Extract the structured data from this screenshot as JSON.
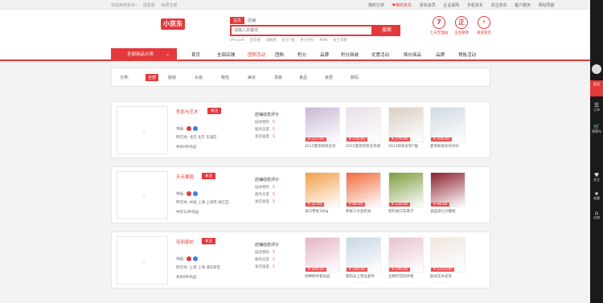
{
  "topbar": {
    "left": [
      "欢迎来到京东!",
      "请登录",
      "免费注册"
    ],
    "right": [
      "我的订单",
      "♥我的京东",
      "京东会员",
      "企业采购",
      "手机京东",
      "关注京东",
      "客户服务",
      "网站导航"
    ]
  },
  "logo": "小京东",
  "search": {
    "tabs": [
      "宝贝",
      "店铺"
    ],
    "placeholder": "请输入关键词",
    "button": "搜索",
    "hotwords": [
      "iPhone6",
      "连衣裙",
      "凉拖鞋",
      "女士T恤",
      "男士衬衫",
      "MINI",
      "女士凉鞋"
    ]
  },
  "promises": [
    {
      "icon": "7",
      "text": "七天无理由"
    },
    {
      "icon": "正",
      "text": "正品保障"
    },
    {
      "icon": "⚡",
      "text": "极速发货"
    }
  ],
  "nav": {
    "category": "全部商品分类",
    "items": [
      "首页",
      "全部店铺",
      "团购活动",
      "团购",
      "积分",
      "品牌",
      "积分商城",
      "优惠活动",
      "降价商品",
      "品牌",
      "预售活动"
    ]
  },
  "filter": {
    "label": "分类:",
    "items": [
      "全部",
      "服装",
      "女装",
      "鞋包",
      "美妆",
      "母婴",
      "食品",
      "家居",
      "数码"
    ]
  },
  "shops": [
    {
      "name": "色彩与艺术",
      "follow": "关注",
      "rank_label": "等级:",
      "location": "所在地: 北京 北京 东城区",
      "sales": "共有0件商品",
      "score_title": "店铺动态评分",
      "scores": [
        {
          "label": "描述相符",
          "value": "5"
        },
        {
          "label": "服务态度",
          "value": "5"
        },
        {
          "label": "发货速度",
          "value": "5"
        }
      ],
      "products": [
        {
          "price": "¥ 213.00",
          "name": "2015夏装新款女装"
        },
        {
          "price": "¥ 156.00",
          "name": "2015夏装新款连衣裙"
        },
        {
          "price": "¥ 279.00",
          "name": "2015新款女装T恤"
        },
        {
          "price": "¥ 108.00",
          "name": "夏季新款条纹衬衫"
        }
      ]
    },
    {
      "name": "天天果园",
      "follow": "关注",
      "rank_label": "等级:",
      "location": "所在地: 中国 上海 上海市 徐汇区",
      "sales": "共有12件商品",
      "score_title": "店铺动态评分",
      "scores": [
        {
          "label": "描述相符",
          "value": "5"
        },
        {
          "label": "服务态度",
          "value": "5"
        },
        {
          "label": "发货速度",
          "value": "5"
        }
      ],
      "products": [
        {
          "price": "¥ 32.00",
          "name": "进口零食180g"
        },
        {
          "price": "¥ 88.00",
          "name": "新鲜三文鱼刺身"
        },
        {
          "price": "¥ 128.00",
          "name": "智利进口车厘子"
        },
        {
          "price": "¥ 98.00",
          "name": "美国进口大樱桃"
        }
      ]
    },
    {
      "name": "佳丽家纺",
      "follow": "关注",
      "rank_label": "等级:",
      "location": "所在地: 上海 上海 浦东新区",
      "sales": "共有8件商品",
      "score_title": "店铺动态评分",
      "scores": [
        {
          "label": "描述相符",
          "value": "5"
        },
        {
          "label": "服务态度",
          "value": "5"
        },
        {
          "label": "发货速度",
          "value": "5"
        }
      ],
      "products": [
        {
          "price": "¥ 168.00",
          "name": "纯棉四件套床品"
        },
        {
          "price": "¥ 189.00",
          "name": "家纺床上用品套件"
        },
        {
          "price": "¥ 199.00",
          "name": "全棉印花四件套"
        },
        {
          "price": "¥ 1233.00",
          "name": "欧式实木床架"
        }
      ]
    }
  ],
  "sidebar": {
    "top_label": "会员",
    "items": [
      {
        "icon": "☰",
        "label": "订单"
      },
      {
        "icon": "🛒",
        "label": "购物车"
      },
      {
        "icon": "♥",
        "label": "关注"
      },
      {
        "icon": "★",
        "label": "收藏"
      },
      {
        "icon": "⌂",
        "label": "店铺"
      }
    ]
  },
  "colors": {
    "brand": "#e4393c"
  }
}
